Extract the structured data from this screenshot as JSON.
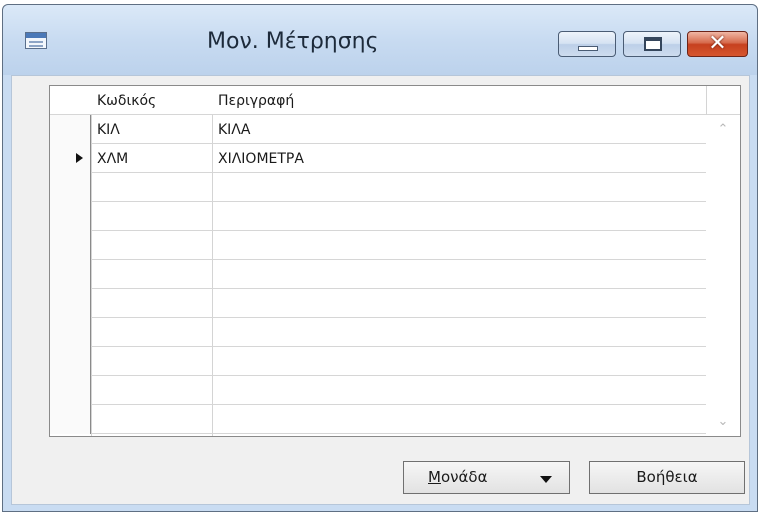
{
  "window": {
    "title": "Μον. Μέτρησης",
    "icon": "form-window-icon",
    "controls": {
      "minimize": "minimize-icon",
      "maximize": "maximize-icon",
      "close": "close-icon"
    }
  },
  "grid": {
    "columns": [
      "Κωδικός",
      "Περιγραφή",
      ""
    ],
    "rows": [
      {
        "code": "ΚΙΛ",
        "description": "ΚΙΛΑ",
        "current": false
      },
      {
        "code": "ΧΛΜ",
        "description": "ΧΙΛΙΟΜΕΤΡΑ",
        "current": true
      },
      {
        "code": "",
        "description": "",
        "current": false
      },
      {
        "code": "",
        "description": "",
        "current": false
      },
      {
        "code": "",
        "description": "",
        "current": false
      },
      {
        "code": "",
        "description": "",
        "current": false
      },
      {
        "code": "",
        "description": "",
        "current": false
      },
      {
        "code": "",
        "description": "",
        "current": false
      },
      {
        "code": "",
        "description": "",
        "current": false
      },
      {
        "code": "",
        "description": "",
        "current": false
      },
      {
        "code": "",
        "description": "",
        "current": false
      }
    ],
    "scroll_up_glyph": "⌃",
    "scroll_down_glyph": "⌄"
  },
  "buttons": {
    "monada_accel": "Μ",
    "monada_rest": "ονάδα",
    "help": "Βοήθεια"
  },
  "colors": {
    "title_bar": "#c8dbf1",
    "close_button": "#c6401f",
    "client_background": "#f0f0f0"
  }
}
